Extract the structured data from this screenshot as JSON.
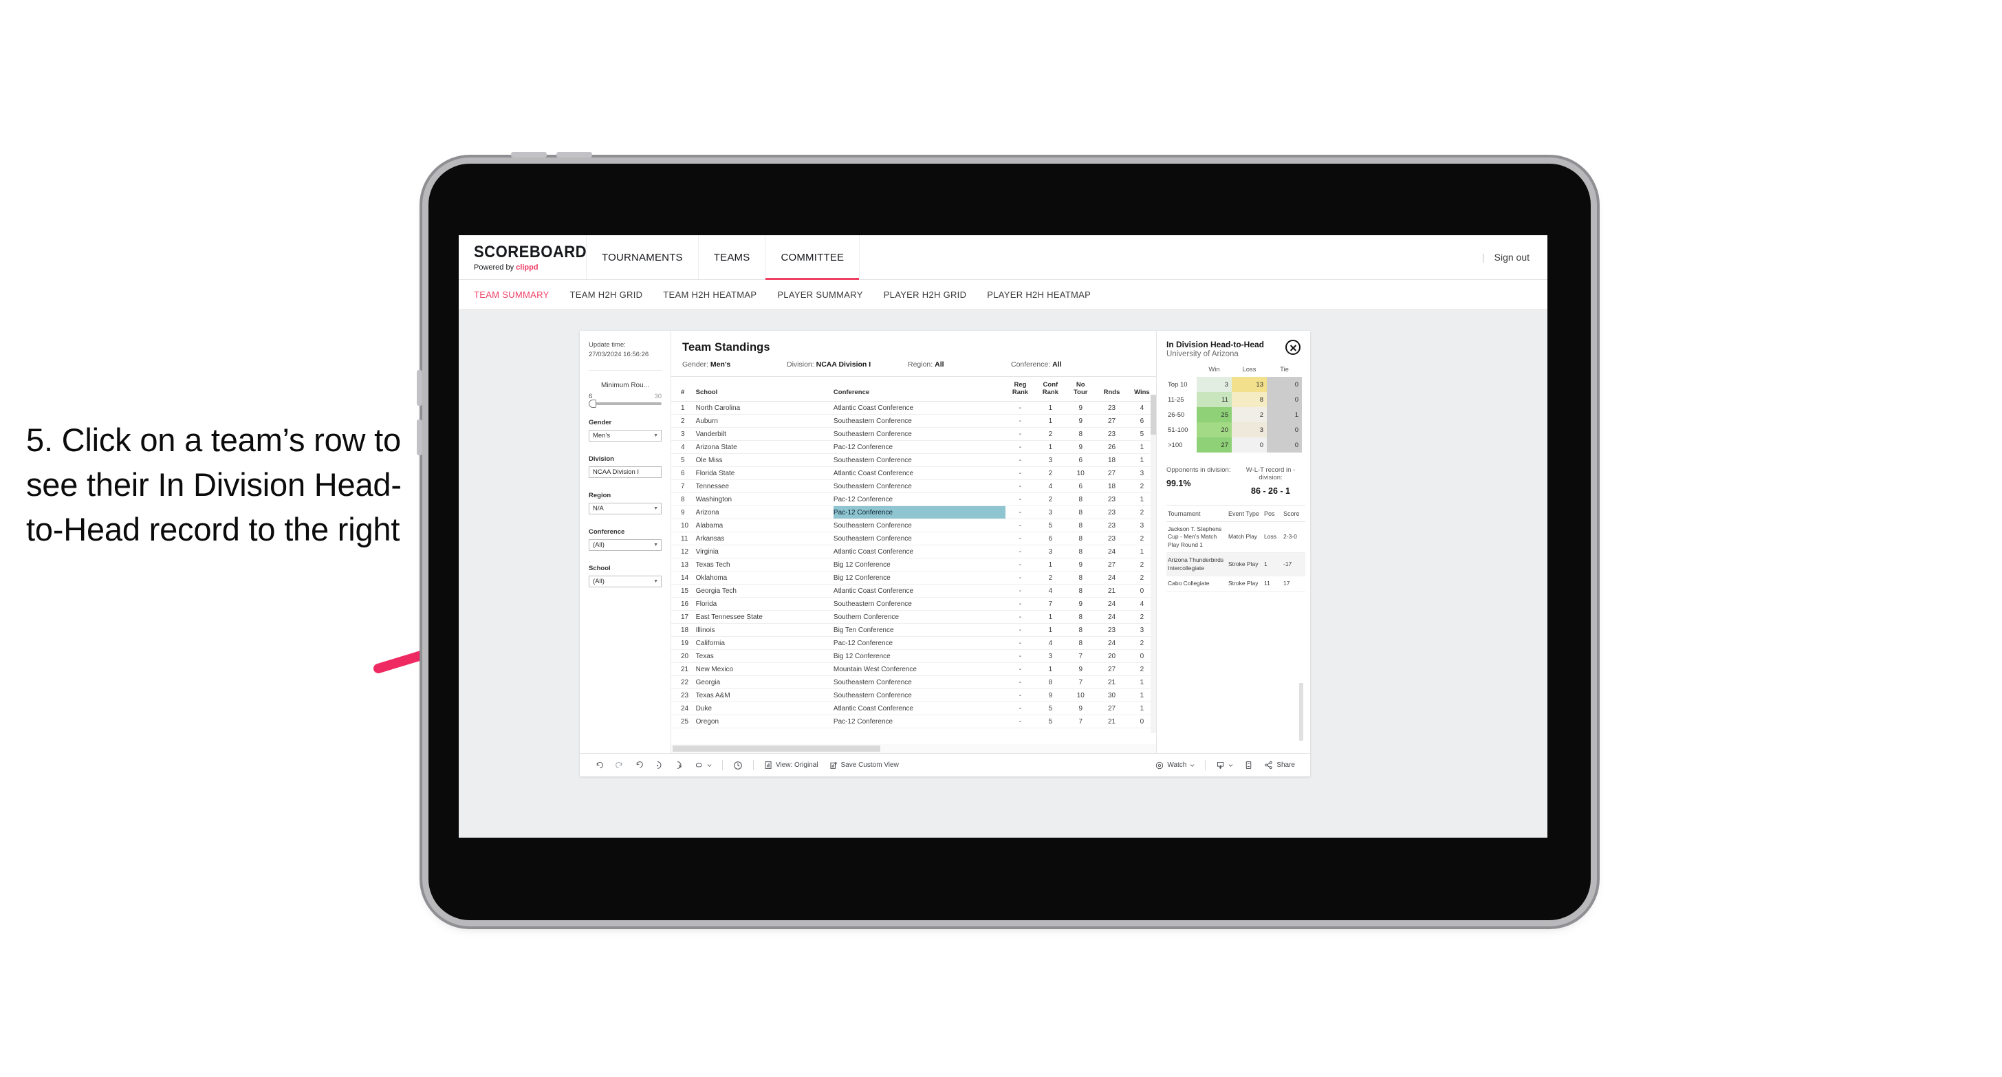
{
  "annotation": {
    "text": "5. Click on a team’s row to see their In Division Head-to-Head record to the right",
    "arrow_color": "#ef2a62"
  },
  "topnav": {
    "brand_title": "SCOREBOARD",
    "brand_sub_prefix": "Powered by ",
    "brand_sub_accent": "clippd",
    "items": [
      {
        "label": "TOURNAMENTS",
        "active": false
      },
      {
        "label": "TEAMS",
        "active": false
      },
      {
        "label": "COMMITTEE",
        "active": true
      }
    ],
    "divider": "|",
    "sign_out": "Sign out"
  },
  "subnav": {
    "tabs": [
      {
        "label": "TEAM SUMMARY",
        "active": true
      },
      {
        "label": "TEAM H2H GRID",
        "active": false
      },
      {
        "label": "TEAM H2H HEATMAP",
        "active": false
      },
      {
        "label": "PLAYER SUMMARY",
        "active": false
      },
      {
        "label": "PLAYER H2H GRID",
        "active": false
      },
      {
        "label": "PLAYER H2H HEATMAP",
        "active": false
      }
    ]
  },
  "rail": {
    "update_label": "Update time:",
    "update_value": "27/03/2024 16:56:26",
    "slider": {
      "label": "Minimum Rou...",
      "min": "6",
      "max": "30"
    },
    "filters": [
      {
        "label": "Gender",
        "value": "Men’s"
      },
      {
        "label": "Division",
        "value": "NCAA Division I"
      },
      {
        "label": "Region",
        "value": "N/A"
      },
      {
        "label": "Conference",
        "value": "(All)"
      },
      {
        "label": "School",
        "value": "(All)"
      }
    ]
  },
  "standings": {
    "title": "Team Standings",
    "summary": [
      {
        "label": "Gender:",
        "value": "Men’s"
      },
      {
        "label": "Division:",
        "value": "NCAA Division I"
      },
      {
        "label": "Region:",
        "value": "All"
      },
      {
        "label": "Conference:",
        "value": "All"
      }
    ],
    "columns": [
      "#",
      "School",
      "Conference",
      "Reg Rank",
      "Conf Rank",
      "No Tour",
      "Rnds",
      "Wins"
    ],
    "rows": [
      {
        "rank": "1",
        "school": "North Carolina",
        "conference": "Atlantic Coast Conference",
        "reg": "-",
        "conf": "1",
        "tour": "9",
        "rnds": "23",
        "wins": "4",
        "selected": false
      },
      {
        "rank": "2",
        "school": "Auburn",
        "conference": "Southeastern Conference",
        "reg": "-",
        "conf": "1",
        "tour": "9",
        "rnds": "27",
        "wins": "6",
        "selected": false
      },
      {
        "rank": "3",
        "school": "Vanderbilt",
        "conference": "Southeastern Conference",
        "reg": "-",
        "conf": "2",
        "tour": "8",
        "rnds": "23",
        "wins": "5",
        "selected": false
      },
      {
        "rank": "4",
        "school": "Arizona State",
        "conference": "Pac-12 Conference",
        "reg": "-",
        "conf": "1",
        "tour": "9",
        "rnds": "26",
        "wins": "1",
        "selected": false
      },
      {
        "rank": "5",
        "school": "Ole Miss",
        "conference": "Southeastern Conference",
        "reg": "-",
        "conf": "3",
        "tour": "6",
        "rnds": "18",
        "wins": "1",
        "selected": false
      },
      {
        "rank": "6",
        "school": "Florida State",
        "conference": "Atlantic Coast Conference",
        "reg": "-",
        "conf": "2",
        "tour": "10",
        "rnds": "27",
        "wins": "3",
        "selected": false
      },
      {
        "rank": "7",
        "school": "Tennessee",
        "conference": "Southeastern Conference",
        "reg": "-",
        "conf": "4",
        "tour": "6",
        "rnds": "18",
        "wins": "2",
        "selected": false
      },
      {
        "rank": "8",
        "school": "Washington",
        "conference": "Pac-12 Conference",
        "reg": "-",
        "conf": "2",
        "tour": "8",
        "rnds": "23",
        "wins": "1",
        "selected": false
      },
      {
        "rank": "9",
        "school": "Arizona",
        "conference": "Pac-12 Conference",
        "reg": "-",
        "conf": "3",
        "tour": "8",
        "rnds": "23",
        "wins": "2",
        "selected": true
      },
      {
        "rank": "10",
        "school": "Alabama",
        "conference": "Southeastern Conference",
        "reg": "-",
        "conf": "5",
        "tour": "8",
        "rnds": "23",
        "wins": "3",
        "selected": false
      },
      {
        "rank": "11",
        "school": "Arkansas",
        "conference": "Southeastern Conference",
        "reg": "-",
        "conf": "6",
        "tour": "8",
        "rnds": "23",
        "wins": "2",
        "selected": false
      },
      {
        "rank": "12",
        "school": "Virginia",
        "conference": "Atlantic Coast Conference",
        "reg": "-",
        "conf": "3",
        "tour": "8",
        "rnds": "24",
        "wins": "1",
        "selected": false
      },
      {
        "rank": "13",
        "school": "Texas Tech",
        "conference": "Big 12 Conference",
        "reg": "-",
        "conf": "1",
        "tour": "9",
        "rnds": "27",
        "wins": "2",
        "selected": false
      },
      {
        "rank": "14",
        "school": "Oklahoma",
        "conference": "Big 12 Conference",
        "reg": "-",
        "conf": "2",
        "tour": "8",
        "rnds": "24",
        "wins": "2",
        "selected": false
      },
      {
        "rank": "15",
        "school": "Georgia Tech",
        "conference": "Atlantic Coast Conference",
        "reg": "-",
        "conf": "4",
        "tour": "8",
        "rnds": "21",
        "wins": "0",
        "selected": false
      },
      {
        "rank": "16",
        "school": "Florida",
        "conference": "Southeastern Conference",
        "reg": "-",
        "conf": "7",
        "tour": "9",
        "rnds": "24",
        "wins": "4",
        "selected": false
      },
      {
        "rank": "17",
        "school": "East Tennessee State",
        "conference": "Southern Conference",
        "reg": "-",
        "conf": "1",
        "tour": "8",
        "rnds": "24",
        "wins": "2",
        "selected": false
      },
      {
        "rank": "18",
        "school": "Illinois",
        "conference": "Big Ten Conference",
        "reg": "-",
        "conf": "1",
        "tour": "8",
        "rnds": "23",
        "wins": "3",
        "selected": false
      },
      {
        "rank": "19",
        "school": "California",
        "conference": "Pac-12 Conference",
        "reg": "-",
        "conf": "4",
        "tour": "8",
        "rnds": "24",
        "wins": "2",
        "selected": false
      },
      {
        "rank": "20",
        "school": "Texas",
        "conference": "Big 12 Conference",
        "reg": "-",
        "conf": "3",
        "tour": "7",
        "rnds": "20",
        "wins": "0",
        "selected": false
      },
      {
        "rank": "21",
        "school": "New Mexico",
        "conference": "Mountain West Conference",
        "reg": "-",
        "conf": "1",
        "tour": "9",
        "rnds": "27",
        "wins": "2",
        "selected": false
      },
      {
        "rank": "22",
        "school": "Georgia",
        "conference": "Southeastern Conference",
        "reg": "-",
        "conf": "8",
        "tour": "7",
        "rnds": "21",
        "wins": "1",
        "selected": false
      },
      {
        "rank": "23",
        "school": "Texas A&M",
        "conference": "Southeastern Conference",
        "reg": "-",
        "conf": "9",
        "tour": "10",
        "rnds": "30",
        "wins": "1",
        "selected": false
      },
      {
        "rank": "24",
        "school": "Duke",
        "conference": "Atlantic Coast Conference",
        "reg": "-",
        "conf": "5",
        "tour": "9",
        "rnds": "27",
        "wins": "1",
        "selected": false
      },
      {
        "rank": "25",
        "school": "Oregon",
        "conference": "Pac-12 Conference",
        "reg": "-",
        "conf": "5",
        "tour": "7",
        "rnds": "21",
        "wins": "0",
        "selected": false
      }
    ]
  },
  "h2h_panel": {
    "title": "In Division Head-to-Head",
    "subtitle": "University of Arizona",
    "close_icon": "close-icon",
    "matrix": {
      "columns": [
        "Win",
        "Loss",
        "Tie"
      ],
      "rows": [
        {
          "bucket": "Top 10",
          "win": "3",
          "loss": "13",
          "tie": "0",
          "win_bg": "#e3eee2",
          "loss_bg": "#f2e08c",
          "tie_bg": "#cccccc"
        },
        {
          "bucket": "11-25",
          "win": "11",
          "loss": "8",
          "tie": "0",
          "win_bg": "#c9e5bd",
          "loss_bg": "#f6ecc3",
          "tie_bg": "#cccccc"
        },
        {
          "bucket": "26-50",
          "win": "25",
          "loss": "2",
          "tie": "1",
          "win_bg": "#8ed177",
          "loss_bg": "#f0eee6",
          "tie_bg": "#cccccc"
        },
        {
          "bucket": "51-100",
          "win": "20",
          "loss": "3",
          "tie": "0",
          "win_bg": "#a2da85",
          "loss_bg": "#efe9dc",
          "tie_bg": "#cccccc"
        },
        {
          "bucket": ">100",
          "win": "27",
          "loss": "0",
          "tie": "0",
          "win_bg": "#8ed177",
          "loss_bg": "#f1f1f1",
          "tie_bg": "#cccccc"
        }
      ]
    },
    "stats": [
      {
        "label": "Opponents in division:",
        "value": "99.1%"
      },
      {
        "label": "W-L-T record in -division:",
        "value": "86 - 26 - 1"
      }
    ],
    "tournaments": {
      "columns": [
        "Tournament",
        "Event Type",
        "Pos",
        "Score"
      ],
      "rows": [
        {
          "name": "Jackson T. Stephens Cup - Men’s Match Play Round 1",
          "event": "Match Play",
          "pos": "Loss",
          "score": "2-3-0",
          "alt": false
        },
        {
          "name": "Arizona Thunderbirds Intercollegiate",
          "event": "Stroke Play",
          "pos": "1",
          "score": "-17",
          "alt": true
        },
        {
          "name": "Cabo Collegiate",
          "event": "Stroke Play",
          "pos": "11",
          "score": "17",
          "alt": false
        }
      ]
    }
  },
  "toolbar": {
    "undo": "undo-icon",
    "redo": "redo-icon",
    "revert": "revert-icon",
    "refresh": "refresh-icon",
    "pause": "pause-icon",
    "shape": "shape-icon",
    "shape_caret": "chevron-down-icon",
    "clock": "clock-icon",
    "view_icon": "view-icon",
    "view_label": "View: Original",
    "save_icon": "save-view-icon",
    "save_label": "Save Custom View",
    "watch_icon": "watch-icon",
    "watch_label": "Watch",
    "watch_caret": "chevron-down-icon",
    "download_icon": "download-icon",
    "download_caret": "chevron-down-icon",
    "fullscreen_icon": "fullscreen-icon",
    "share_icon": "share-icon",
    "share_label": "Share"
  }
}
